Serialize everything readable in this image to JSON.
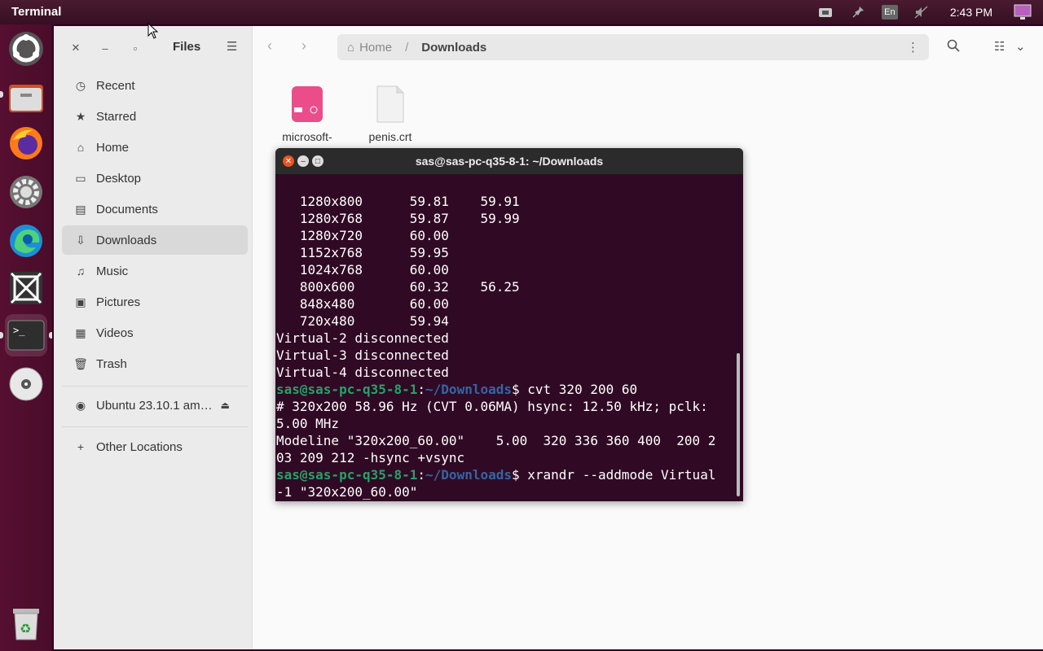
{
  "topbar": {
    "app_name": "Terminal",
    "clock": "2:43 PM",
    "keyboard_layout": "En"
  },
  "dock": {
    "items": [
      "ubuntu-installer",
      "files",
      "firefox",
      "settings",
      "edge",
      "app",
      "terminal",
      "disc",
      "trash"
    ]
  },
  "files": {
    "title": "Files",
    "sidebar": {
      "items": [
        {
          "label": "Recent",
          "icon": "clock-icon"
        },
        {
          "label": "Starred",
          "icon": "star-icon"
        },
        {
          "label": "Home",
          "icon": "home-icon"
        },
        {
          "label": "Desktop",
          "icon": "desktop-icon"
        },
        {
          "label": "Documents",
          "icon": "documents-icon"
        },
        {
          "label": "Downloads",
          "icon": "download-icon"
        },
        {
          "label": "Music",
          "icon": "music-icon"
        },
        {
          "label": "Pictures",
          "icon": "pictures-icon"
        },
        {
          "label": "Videos",
          "icon": "videos-icon"
        },
        {
          "label": "Trash",
          "icon": "trash-icon"
        }
      ],
      "device": "Ubuntu 23.10.1 am…",
      "other": "Other Locations"
    },
    "path": {
      "home": "Home",
      "current": "Downloads"
    },
    "files": [
      {
        "name": "microsoft-"
      },
      {
        "name": "penis.crt"
      }
    ]
  },
  "terminal": {
    "title": "sas@sas-pc-q35-8-1: ~/Downloads",
    "lines": [
      "   1280x800      59.81    59.91  ",
      "   1280x768      59.87    59.99  ",
      "   1280x720      60.00  ",
      "   1152x768      59.95  ",
      "   1024x768      60.00  ",
      "   800x600       60.32    56.25  ",
      "   848x480       60.00  ",
      "   720x480       59.94  ",
      "Virtual-2 disconnected",
      "Virtual-3 disconnected",
      "Virtual-4 disconnected"
    ],
    "prompt_user": "sas@sas-pc-q35-8-1",
    "prompt_path": "~/Downloads",
    "cmd1": "$ cvt 320 200 60",
    "out1": "# 320x200 58.96 Hz (CVT 0.06MA) hsync: 12.50 kHz; pclk:",
    "out2": "5.00 MHz",
    "out3": "Modeline \"320x200_60.00\"    5.00  320 336 360 400  200 2",
    "out4": "03 209 212 -hsync +vsync",
    "cmd2": "$ xrandr --addmode Virtual",
    "cmd2b": "-1 \"320x200_60.00\"",
    "cmd3": "$ "
  }
}
